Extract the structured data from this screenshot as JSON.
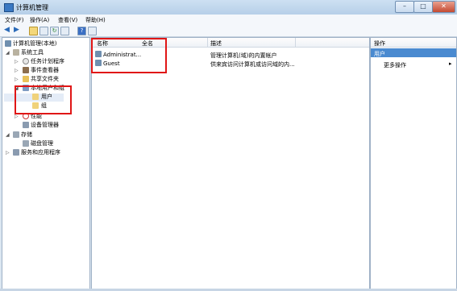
{
  "window": {
    "title": "计算机管理",
    "buttons": {
      "minimize": "–",
      "maximize": "□",
      "close": "✕"
    }
  },
  "menu": [
    "文件(F)",
    "操作(A)",
    "查看(V)",
    "帮助(H)"
  ],
  "toolbar": [
    "back",
    "forward",
    "up",
    "show-tree",
    "refresh",
    "export",
    "help",
    "properties"
  ],
  "tree": {
    "root": "计算机管理(本地)",
    "system_tools": "系统工具",
    "task_scheduler": "任务计划程序",
    "event_viewer": "事件查看器",
    "shared_folders": "共享文件夹",
    "local_users_groups": "本地用户和组",
    "users": "用户",
    "groups": "组",
    "performance": "性能",
    "device_manager": "设备管理器",
    "storage": "存储",
    "disk_management": "磁盘管理",
    "services_apps": "服务和应用程序"
  },
  "list": {
    "columns": {
      "name": "名称",
      "fullname": "全名",
      "description": "描述"
    },
    "rows": [
      {
        "name": "Administrat...",
        "fullname": "",
        "description": "管理计算机(域)的内置帐户"
      },
      {
        "name": "Guest",
        "fullname": "",
        "description": "供来宾访问计算机或访问域的内..."
      }
    ]
  },
  "actions": {
    "header": "操作",
    "section": "用户",
    "more": "更多操作",
    "more_arrow": "▸"
  }
}
